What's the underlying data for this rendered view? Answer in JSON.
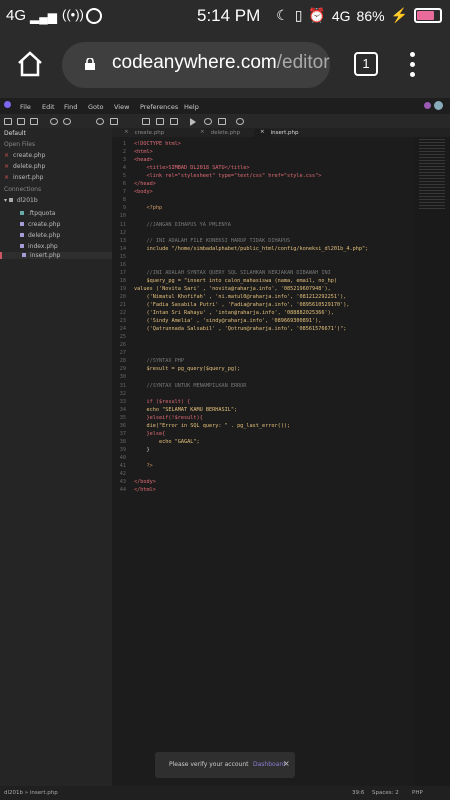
{
  "status_bar": {
    "carrier": "4G",
    "time": "5:14 PM",
    "network": "4G",
    "battery": "86%",
    "battery_level": 0.86
  },
  "browser": {
    "domain": "codeanywhere.com",
    "path": "/editor",
    "tab_count": "1"
  },
  "menu": {
    "items": [
      "File",
      "Edit",
      "Find",
      "Goto",
      "View",
      "Preferences",
      "Help"
    ]
  },
  "sidebar": {
    "default_label": "Default",
    "open_files_label": "Open Files",
    "open_files": [
      "create.php",
      "delete.php",
      "insert.php"
    ],
    "connections_label": "Connections",
    "connection_name": "dl201b",
    "tree": [
      ".ftpquota",
      "create.php",
      "delete.php",
      "index.php",
      "insert.php"
    ]
  },
  "tabs": [
    "create.php",
    "delete.php",
    "insert.php"
  ],
  "code_lines": [
    {
      "n": "1",
      "t": "<!DOCTYPE html>",
      "c": "#e06c75"
    },
    {
      "n": "2",
      "t": "<html>",
      "c": "#e06c75"
    },
    {
      "n": "3",
      "t": "<head>",
      "c": "#e06c75"
    },
    {
      "n": "4",
      "t": "    <title>SIMBAD DL2018 SATU</title>",
      "c": "#e06c75"
    },
    {
      "n": "5",
      "t": "    <link rel=\"stylesheet\" type=\"text/css\" href=\"style.css\">",
      "c": "#e06c75"
    },
    {
      "n": "6",
      "t": "</head>",
      "c": "#e06c75"
    },
    {
      "n": "7",
      "t": "<body>",
      "c": "#e06c75"
    },
    {
      "n": "8",
      "t": "",
      "c": "#ccc"
    },
    {
      "n": "9",
      "t": "    <?php",
      "c": "#d19a66"
    },
    {
      "n": "10",
      "t": "",
      "c": "#ccc"
    },
    {
      "n": "11",
      "t": "    //JANGAN DIHAPUS YA PMLENYA",
      "c": "#777"
    },
    {
      "n": "12",
      "t": "",
      "c": "#ccc"
    },
    {
      "n": "13",
      "t": "    // INI ADALAH FILE KONEKSI HARUP TIDAK DIHAPUS",
      "c": "#777"
    },
    {
      "n": "14",
      "t": "    include \"/home/simbadalphabet/public_html/config/koneksi_dl201b_4.php\";",
      "c": "#e5c07b"
    },
    {
      "n": "15",
      "t": "",
      "c": "#ccc"
    },
    {
      "n": "16",
      "t": "",
      "c": "#ccc"
    },
    {
      "n": "17",
      "t": "    //INI ADALAH SYNTAX QUERY SQL SILAHKAN KERJAKAN DIBAWAH INI",
      "c": "#777"
    },
    {
      "n": "18",
      "t": "    $query_pg = \"insert into calon_mahasiswa (nama, email, no_hp)",
      "c": "#e5c07b"
    },
    {
      "n": "19",
      "t": "values ('Novita Sari' , 'novita@raharja.info', '085219607948'),",
      "c": "#e5c07b"
    },
    {
      "n": "20",
      "t": "    ('Nimatul Khofifah' , 'ni.matul0@raharja.info', '081212292251'),",
      "c": "#e5c07b"
    },
    {
      "n": "21",
      "t": "    ('Fadia Sasabila Putri' , 'Fadia@raharja.info', '0895610529170'),",
      "c": "#e5c07b"
    },
    {
      "n": "22",
      "t": "    ('Intan Sri Rahayu' , 'intan@raharja.info', '088882025366'),",
      "c": "#e5c07b"
    },
    {
      "n": "23",
      "t": "    ('Sindy Amelia' , 'sindy@raharja.info', '089669300891'),",
      "c": "#e5c07b"
    },
    {
      "n": "24",
      "t": "    ('Qatrunnada Salsabil' , 'Qotrun@raharja.info', '08561576671')\";",
      "c": "#e5c07b"
    },
    {
      "n": "25",
      "t": "",
      "c": "#ccc"
    },
    {
      "n": "26",
      "t": "",
      "c": "#ccc"
    },
    {
      "n": "27",
      "t": "",
      "c": "#ccc"
    },
    {
      "n": "28",
      "t": "    //SYNTAX PHP",
      "c": "#777"
    },
    {
      "n": "29",
      "t": "    $result = pg_query($query_pg);",
      "c": "#e5c07b"
    },
    {
      "n": "30",
      "t": "",
      "c": "#ccc"
    },
    {
      "n": "31",
      "t": "    //SYNTAX UNTUK MENAMPILKAN ERROR",
      "c": "#777"
    },
    {
      "n": "32",
      "t": "",
      "c": "#ccc"
    },
    {
      "n": "33",
      "t": "    if ($result) {",
      "c": "#e06c75"
    },
    {
      "n": "34",
      "t": "    echo \"SELAMAT KAMU BERHASIL\";",
      "c": "#e5c07b"
    },
    {
      "n": "35",
      "t": "    }elseif(!$result){",
      "c": "#e06c75"
    },
    {
      "n": "36",
      "t": "    die(\"Error in SQL query: \" . pg_last_error());",
      "c": "#e5c07b"
    },
    {
      "n": "37",
      "t": "    }else{",
      "c": "#e06c75"
    },
    {
      "n": "38",
      "t": "        echo \"GAGAL\";",
      "c": "#e5c07b"
    },
    {
      "n": "39",
      "t": "    }",
      "c": "#ccc"
    },
    {
      "n": "40",
      "t": "",
      "c": "#ccc"
    },
    {
      "n": "41",
      "t": "    ?>",
      "c": "#d19a66"
    },
    {
      "n": "42",
      "t": "",
      "c": "#ccc"
    },
    {
      "n": "43",
      "t": "</body>",
      "c": "#e06c75"
    },
    {
      "n": "44",
      "t": "</html>",
      "c": "#e06c75"
    }
  ],
  "toast": {
    "message": "Please verify your account",
    "link": "Dashboard"
  },
  "footer": {
    "path": "dl201b » insert.php",
    "position": "39:6",
    "spaces": "Spaces: 2",
    "language": "PHP"
  }
}
